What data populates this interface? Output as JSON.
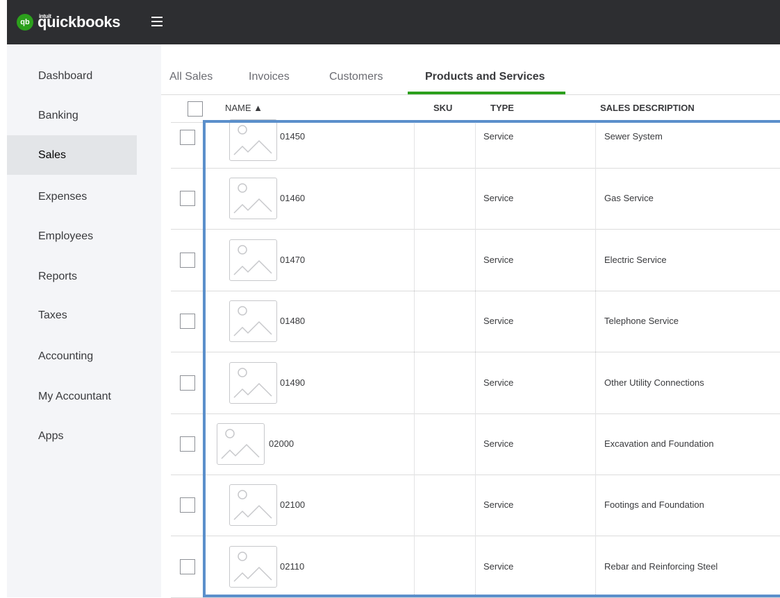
{
  "app": {
    "brand": "quickbooks",
    "brand_sup": "intuit",
    "logo_mark": "qb"
  },
  "colors": {
    "topbar": "#2d2e31",
    "accent": "#2ca01c",
    "selection": "#5b8fcb"
  },
  "sidebar": {
    "items": [
      {
        "label": "Dashboard"
      },
      {
        "label": "Banking"
      },
      {
        "label": "Sales"
      },
      {
        "label": "Expenses"
      },
      {
        "label": "Employees"
      },
      {
        "label": "Reports"
      },
      {
        "label": "Taxes"
      },
      {
        "label": "Accounting"
      },
      {
        "label": "My Accountant"
      },
      {
        "label": "Apps"
      }
    ],
    "active": "Sales"
  },
  "tabs": [
    {
      "label": "All Sales"
    },
    {
      "label": "Invoices"
    },
    {
      "label": "Customers"
    },
    {
      "label": "Products and Services"
    }
  ],
  "table": {
    "headers": {
      "name": "NAME ▲",
      "sku": "SKU",
      "type": "TYPE",
      "sales_description": "SALES DESCRIPTION"
    },
    "rows": [
      {
        "name": "01450",
        "sku": "",
        "type": "Service",
        "description": "Sewer System"
      },
      {
        "name": "01460",
        "sku": "",
        "type": "Service",
        "description": "Gas Service"
      },
      {
        "name": "01470",
        "sku": "",
        "type": "Service",
        "description": "Electric Service"
      },
      {
        "name": "01480",
        "sku": "",
        "type": "Service",
        "description": "Telephone Service"
      },
      {
        "name": "01490",
        "sku": "",
        "type": "Service",
        "description": "Other Utility Connections"
      },
      {
        "name": "02000",
        "sku": "",
        "type": "Service",
        "description": "Excavation and Foundation"
      },
      {
        "name": "02100",
        "sku": "",
        "type": "Service",
        "description": "Footings and Foundation"
      },
      {
        "name": "02110",
        "sku": "",
        "type": "Service",
        "description": "Rebar and Reinforcing Steel"
      }
    ]
  }
}
